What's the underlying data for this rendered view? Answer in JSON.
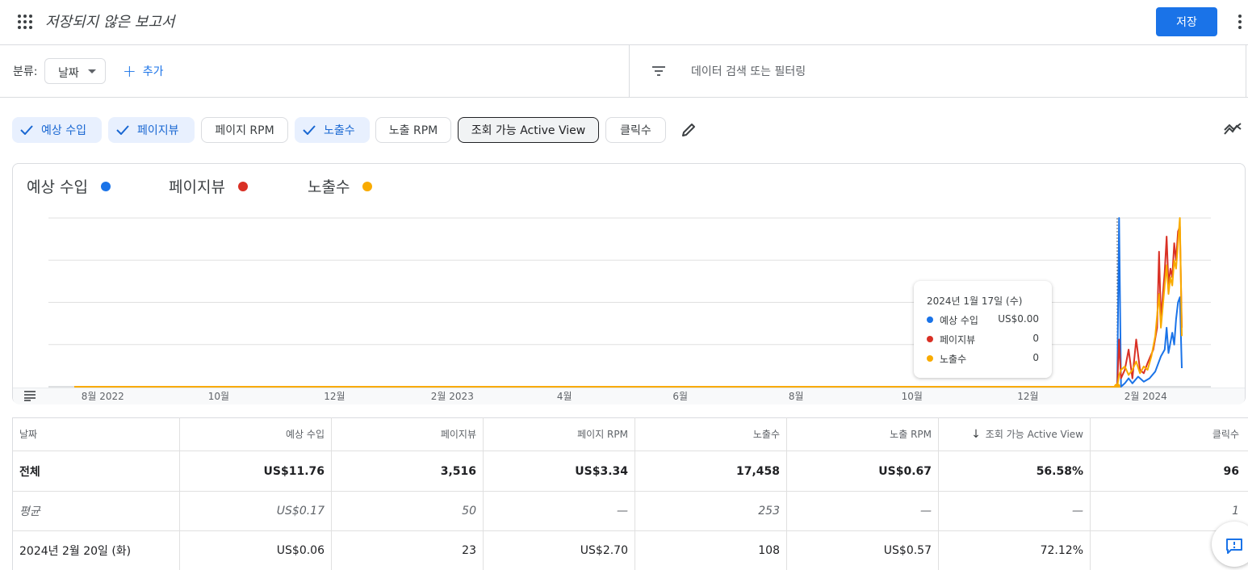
{
  "header": {
    "title": "저장되지 않은 보고서",
    "save_label": "저장"
  },
  "filterbar": {
    "group_label": "분류:",
    "group_value": "날짜",
    "add_label": "추가",
    "search_placeholder": "데이터 검색 또는 필터링"
  },
  "metric_chips": [
    {
      "label": "예상 수입",
      "selected": true
    },
    {
      "label": "페이지뷰",
      "selected": true
    },
    {
      "label": "페이지 RPM",
      "selected": false
    },
    {
      "label": "노출수",
      "selected": true
    },
    {
      "label": "노출 RPM",
      "selected": false
    },
    {
      "label": "조회 가능 Active View",
      "selected": false,
      "sort_active": true
    },
    {
      "label": "클릭수",
      "selected": false
    }
  ],
  "colors": {
    "earnings": "#1a73e8",
    "pageviews": "#d93025",
    "impressions": "#f9ab00",
    "accent": "#1a73e8"
  },
  "chart_data": {
    "type": "line",
    "legend": [
      "예상 수입",
      "페이지뷰",
      "노출수"
    ],
    "x_ticks": [
      "8월 2022",
      "10월",
      "12월",
      "2월 2023",
      "4월",
      "6월",
      "8월",
      "10월",
      "12월",
      "2월 2024"
    ],
    "x_range": [
      "2022-07-17",
      "2024-02-20"
    ],
    "grid": true,
    "y_axis_labels": false,
    "series": [
      {
        "name": "예상 수입",
        "color": "#1a73e8",
        "relative_values": [
          [
            "2022-07-17",
            0
          ],
          [
            "2024-01-17",
            0
          ],
          [
            "2024-01-18",
            1.0
          ],
          [
            "2024-01-19",
            0.0
          ],
          [
            "2024-01-21",
            0.02
          ],
          [
            "2024-01-23",
            0.05
          ],
          [
            "2024-01-25",
            0.02
          ],
          [
            "2024-01-28",
            0.06
          ],
          [
            "2024-01-31",
            0.03
          ],
          [
            "2024-02-03",
            0.05
          ],
          [
            "2024-02-06",
            0.09
          ],
          [
            "2024-02-09",
            0.18
          ],
          [
            "2024-02-11",
            0.22
          ],
          [
            "2024-02-12",
            0.35
          ],
          [
            "2024-02-13",
            0.2
          ],
          [
            "2024-02-15",
            0.32
          ],
          [
            "2024-02-16",
            0.25
          ],
          [
            "2024-02-17",
            0.4
          ],
          [
            "2024-02-18",
            0.5
          ],
          [
            "2024-02-19",
            0.53
          ],
          [
            "2024-02-20",
            0.11
          ]
        ]
      },
      {
        "name": "페이지뷰",
        "color": "#d93025",
        "relative_values": [
          [
            "2022-07-17",
            0
          ],
          [
            "2024-01-17",
            0
          ],
          [
            "2024-01-18",
            0.28
          ],
          [
            "2024-01-19",
            0.05
          ],
          [
            "2024-01-21",
            0.1
          ],
          [
            "2024-01-23",
            0.22
          ],
          [
            "2024-01-25",
            0.05
          ],
          [
            "2024-01-27",
            0.28
          ],
          [
            "2024-01-29",
            0.1
          ],
          [
            "2024-01-31",
            0.08
          ],
          [
            "2024-02-02",
            0.14
          ],
          [
            "2024-02-05",
            0.22
          ],
          [
            "2024-02-07",
            0.35
          ],
          [
            "2024-02-08",
            0.8
          ],
          [
            "2024-02-09",
            0.4
          ],
          [
            "2024-02-11",
            0.68
          ],
          [
            "2024-02-12",
            0.89
          ],
          [
            "2024-02-13",
            0.6
          ],
          [
            "2024-02-14",
            0.7
          ],
          [
            "2024-02-15",
            0.65
          ],
          [
            "2024-02-16",
            0.85
          ],
          [
            "2024-02-17",
            0.75
          ],
          [
            "2024-02-18",
            0.92
          ],
          [
            "2024-02-19",
            0.95
          ],
          [
            "2024-02-20",
            0.35
          ]
        ]
      },
      {
        "name": "노출수",
        "color": "#f9ab00",
        "relative_values": [
          [
            "2022-07-17",
            0
          ],
          [
            "2024-01-17",
            0
          ],
          [
            "2024-01-18",
            0.07
          ],
          [
            "2024-01-19",
            0.1
          ],
          [
            "2024-01-21",
            0.12
          ],
          [
            "2024-01-23",
            0.07
          ],
          [
            "2024-01-25",
            0.1
          ],
          [
            "2024-01-27",
            0.15
          ],
          [
            "2024-01-29",
            0.08
          ],
          [
            "2024-01-31",
            0.12
          ],
          [
            "2024-02-02",
            0.1
          ],
          [
            "2024-02-04",
            0.18
          ],
          [
            "2024-02-06",
            0.3
          ],
          [
            "2024-02-08",
            0.55
          ],
          [
            "2024-02-09",
            0.35
          ],
          [
            "2024-02-11",
            0.6
          ],
          [
            "2024-02-12",
            0.72
          ],
          [
            "2024-02-13",
            0.55
          ],
          [
            "2024-02-14",
            0.65
          ],
          [
            "2024-02-15",
            0.6
          ],
          [
            "2024-02-16",
            0.75
          ],
          [
            "2024-02-17",
            0.7
          ],
          [
            "2024-02-18",
            0.85
          ],
          [
            "2024-02-19",
            1.0
          ],
          [
            "2024-02-20",
            0.3
          ]
        ]
      }
    ],
    "tooltip": {
      "date": "2024년 1월 17일 (수)",
      "rows": [
        {
          "name": "예상 수입",
          "value": "US$0.00"
        },
        {
          "name": "페이지뷰",
          "value": "0"
        },
        {
          "name": "노출수",
          "value": "0"
        }
      ]
    }
  },
  "table": {
    "columns": [
      "날짜",
      "예상 수입",
      "페이지뷰",
      "페이지 RPM",
      "노출수",
      "노출 RPM",
      "조회 가능 Active View",
      "클릭수"
    ],
    "sorted_column": "조회 가능 Active View",
    "sort_direction": "descending",
    "total": [
      "전체",
      "US$11.76",
      "3,516",
      "US$3.34",
      "17,458",
      "US$0.67",
      "56.58%",
      "96"
    ],
    "average": [
      "평균",
      "US$0.17",
      "50",
      "—",
      "253",
      "—",
      "—",
      "1"
    ],
    "rows": [
      [
        "2024년 2월 20일 (화)",
        "US$0.06",
        "23",
        "US$2.70",
        "108",
        "US$0.57",
        "72.12%",
        ""
      ]
    ]
  }
}
